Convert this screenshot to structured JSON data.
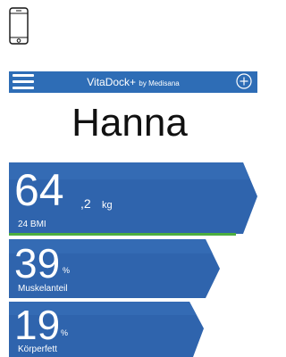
{
  "device_icon": "smartphone-icon",
  "header": {
    "menu_icon": "hamburger-menu-icon",
    "title": "VitaDock+",
    "title_by": "by Medisana",
    "add_icon": "plus-circle-icon",
    "bg_color": "#2e6db6"
  },
  "user": {
    "name": "Hanna"
  },
  "metrics": [
    {
      "value": "64",
      "decimal": ",2",
      "unit": "kg",
      "label": "24 BMI"
    },
    {
      "value": "39",
      "unit": "%",
      "label": "Muskelanteil"
    },
    {
      "value": "19",
      "unit": "%",
      "label": "Körperfett"
    }
  ],
  "colors": {
    "card": "#2f64ad",
    "card_shadow": "#24579c",
    "accent_green": "#4cae3f"
  }
}
